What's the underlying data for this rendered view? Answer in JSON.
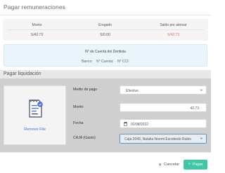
{
  "modal": {
    "title": "Pagar remuneraciones"
  },
  "summary": {
    "columns": [
      {
        "header": "Monto",
        "value": "S/42.73",
        "accent": "normal"
      },
      {
        "header": "Erogado",
        "value": "S/0.00",
        "accent": "normal"
      },
      {
        "header": "Saldo por abonar",
        "value": "S/42.73",
        "accent": "red"
      }
    ]
  },
  "bank": {
    "title": "N° de Cuenta del Dentista",
    "banco": "Banco:",
    "cuenta": "N° Cuenta:",
    "cci": "N° CCI:"
  },
  "payment": {
    "section_title": "Pagar liquidación",
    "upload_label": "Remove File",
    "fields": {
      "medio_label": "Medio de pago",
      "medio_value": "Efectivo",
      "monto_label": "Monto",
      "monto_value": "42.73",
      "fecha_label": "Fecha",
      "fecha_value": "02/08/2022",
      "caja_label": "CAJA (Gasto)",
      "caja_value": "Caja 2049, Natalia Noemi Escobedo Rubio"
    }
  },
  "footer": {
    "cancel_label": "Cancelar",
    "pay_label": "Pagar"
  },
  "colors": {
    "accent_green": "#3ec6a6",
    "saldo_red": "#e46a5b",
    "link_blue": "#4a6fd6"
  }
}
